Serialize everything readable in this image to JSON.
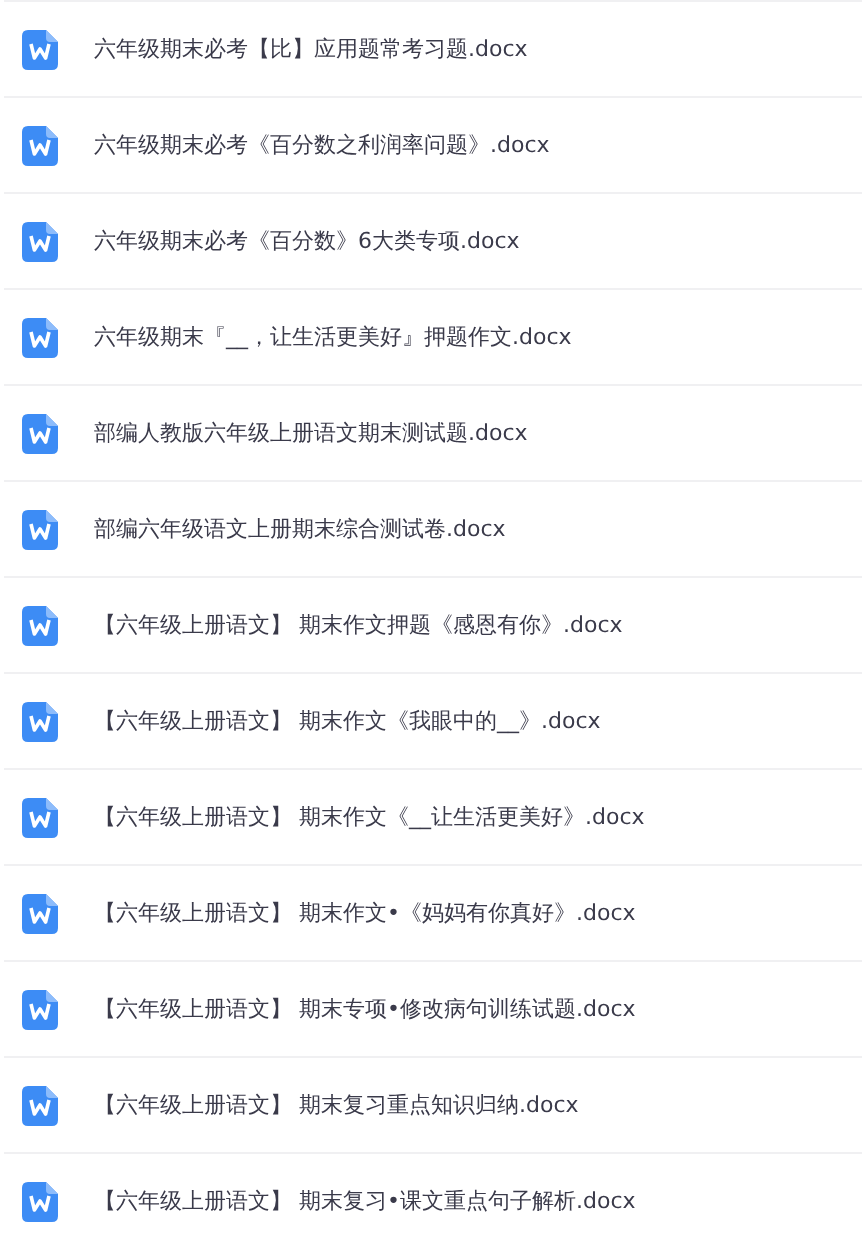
{
  "files": [
    {
      "name": "六年级期末必考【比】应用题常考习题.docx"
    },
    {
      "name": "六年级期末必考《百分数之利润率问题》.docx"
    },
    {
      "name": "六年级期末必考《百分数》6大类专项.docx"
    },
    {
      "name": "六年级期末『__，让生活更美好』押题作文.docx"
    },
    {
      "name": "部编人教版六年级上册语文期末测试题.docx"
    },
    {
      "name": "部编六年级语文上册期末综合测试卷.docx"
    },
    {
      "name": "【六年级上册语文】 期末作文押题《感恩有你》.docx"
    },
    {
      "name": "【六年级上册语文】 期末作文《我眼中的__》.docx"
    },
    {
      "name": "【六年级上册语文】 期末作文《__让生活更美好》.docx"
    },
    {
      "name": "【六年级上册语文】 期末作文•《妈妈有你真好》.docx"
    },
    {
      "name": "【六年级上册语文】 期末专项•修改病句训练试题.docx"
    },
    {
      "name": "【六年级上册语文】 期末复习重点知识归纳.docx"
    },
    {
      "name": "【六年级上册语文】 期末复习•课文重点句子解析.docx"
    }
  ]
}
